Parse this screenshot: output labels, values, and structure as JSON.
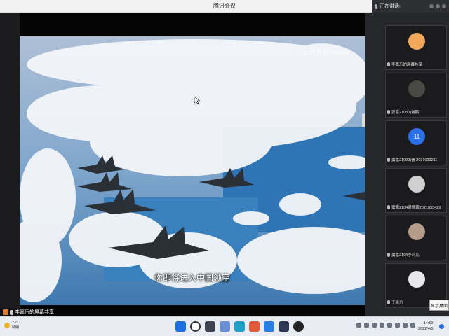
{
  "window": {
    "title": "腾讯会议"
  },
  "video": {
    "watermark": "广东共青团 bilibili",
    "subtitle": "你即将进入中国领空"
  },
  "sharing": {
    "label": "李嘉乐的屏幕共享"
  },
  "panel": {
    "header": "正在讲话:",
    "participants": [
      {
        "name": "李嘉乐的屏幕共享",
        "avatar_color": "#f2a85b"
      },
      {
        "name": "窦嘉21030)谢鹏",
        "avatar_color": "#4a4a44"
      },
      {
        "name": "窦嘉21029)曹 2021033211",
        "avatar_text": "11",
        "avatar_color": "#2a6fe6"
      },
      {
        "name": "窦嘉2104梁雅茜2021033429",
        "avatar_color": "#cfcfcf"
      },
      {
        "name": "窦嘉2104李莉儿",
        "avatar_color": "#b59c8a"
      },
      {
        "name": "王晓丹",
        "avatar_color": "#e8e8ec"
      }
    ],
    "show_desktop": "显示桌面"
  },
  "taskbar": {
    "weather_temp": "23°C",
    "weather_desc": "晴朗",
    "time": "14:59",
    "date": "2022/4/5"
  },
  "colors": {
    "accent": "#2a6fe6",
    "panel_bg": "#26272b"
  }
}
